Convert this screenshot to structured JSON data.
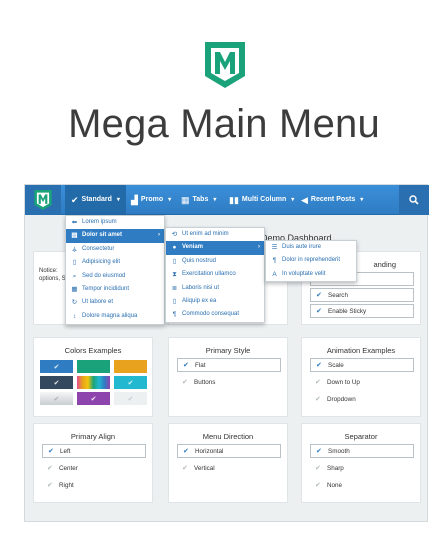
{
  "brand": {
    "title": "Mega Main Menu",
    "logo_icon": "m-logo-icon",
    "logo_color": "#1aa37a"
  },
  "navbar": {
    "items": [
      {
        "icon": "check-icon",
        "label": "Standard"
      },
      {
        "icon": "chart-icon",
        "label": "Promo"
      },
      {
        "icon": "tabs-icon",
        "label": "Tabs"
      },
      {
        "icon": "columns-icon",
        "label": "Multi Column"
      },
      {
        "icon": "megaphone-icon",
        "label": "Recent Posts"
      }
    ],
    "search_icon": "search-icon",
    "bar_color": "#2f7cc3"
  },
  "dashboard_title": "Demo Dashboard",
  "notice_text": "Notice: options, S",
  "menus": {
    "level1": [
      {
        "icon": "arrow-left-icon",
        "label": "Lorem ipsum"
      },
      {
        "icon": "table-icon",
        "label": "Dolor sit amet",
        "highlighted": true
      },
      {
        "icon": "sitemap-icon",
        "label": "Consectetur"
      },
      {
        "icon": "file-icon",
        "label": "Adipisicing elit"
      },
      {
        "icon": "search-icon",
        "label": "Sed do eiusmod"
      },
      {
        "icon": "film-icon",
        "label": "Tempor incididunt"
      },
      {
        "icon": "refresh-icon",
        "label": "Ut labore et"
      },
      {
        "icon": "resize-icon",
        "label": "Dolore magna aliqua"
      }
    ],
    "level2": [
      {
        "icon": "history-icon",
        "label": "Ut enim ad minim"
      },
      {
        "icon": "globe-icon",
        "label": "Veniam",
        "highlighted": true
      },
      {
        "icon": "file-icon",
        "label": "Quis nostrud"
      },
      {
        "icon": "hourglass-icon",
        "label": "Exercitation ullamco"
      },
      {
        "icon": "list-icon",
        "label": "Laboris nisi ut"
      },
      {
        "icon": "file-icon",
        "label": "Aliquip ex ea"
      },
      {
        "icon": "pilcrow-icon",
        "label": "Commodo consequat"
      }
    ],
    "level3": [
      {
        "icon": "align-icon",
        "label": "Duis aute irure"
      },
      {
        "icon": "pilcrow-icon",
        "label": "Dolor in reprehenderit"
      },
      {
        "icon": "font-icon",
        "label": "In voluptate velit"
      }
    ]
  },
  "cards": {
    "branding": {
      "title": "anding",
      "options": [
        {
          "label": "",
          "selected": true
        },
        {
          "label": "Search",
          "selected": true
        },
        {
          "label": "Enable Sticky",
          "selected": true
        }
      ]
    },
    "colors": {
      "title": "Colors Examples",
      "swatches": [
        "#2f7cc3",
        "#1aa37a",
        "#e8a21d",
        "#34495e",
        "#e74c8f",
        "#22b8cf",
        "#d9dde0",
        "#8e44ad",
        "#ecf0f1"
      ]
    },
    "primary_style": {
      "title": "Primary Style",
      "options": [
        {
          "label": "Flat",
          "selected": true
        },
        {
          "label": "Buttons",
          "selected": false
        }
      ]
    },
    "animation": {
      "title": "Animation Examples",
      "options": [
        {
          "label": "Scale",
          "selected": true
        },
        {
          "label": "Down to Up",
          "selected": false
        },
        {
          "label": "Dropdown",
          "selected": false
        }
      ]
    },
    "align": {
      "title": "Primary Align",
      "options": [
        {
          "label": "Left",
          "selected": true
        },
        {
          "label": "Center",
          "selected": false
        },
        {
          "label": "Right",
          "selected": false
        }
      ]
    },
    "direction": {
      "title": "Menu Direction",
      "options": [
        {
          "label": "Horizontal",
          "selected": true
        },
        {
          "label": "Vertical",
          "selected": false
        }
      ]
    },
    "separator": {
      "title": "Separator",
      "options": [
        {
          "label": "Smooth",
          "selected": true
        },
        {
          "label": "Sharp",
          "selected": false
        },
        {
          "label": "None",
          "selected": false
        }
      ]
    }
  }
}
